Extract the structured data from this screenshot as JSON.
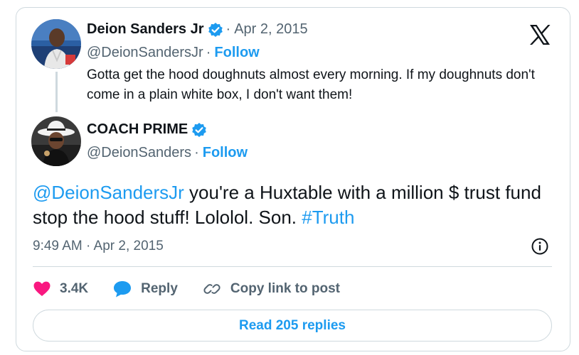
{
  "quoted_tweet": {
    "author_name": "Deion Sanders Jr",
    "handle": "@DeionSandersJr",
    "follow_label": "Follow",
    "separator": "·",
    "date": "Apr 2, 2015",
    "text": "Gotta get the hood doughnuts almost every morning. If my doughnuts don't come in a plain white box, I don't want them!"
  },
  "main_tweet": {
    "author_name": "COACH PRIME",
    "handle": "@DeionSanders",
    "follow_label": "Follow",
    "separator": "·",
    "mention": "@DeionSandersJr",
    "text_body": " you're a Huxtable with a million $ trust fund stop the hood stuff! Lololol. Son. ",
    "hashtag": "#Truth",
    "timestamp": "9:49 AM · Apr 2, 2015"
  },
  "actions": {
    "likes_count": "3.4K",
    "reply_label": "Reply",
    "copy_link_label": "Copy link to post"
  },
  "read_replies_label": "Read 205 replies",
  "icons": {
    "verified": "verified-badge-icon",
    "x_logo": "x-logo-icon",
    "info": "info-icon",
    "heart": "heart-icon",
    "reply": "reply-bubble-icon",
    "link": "link-icon"
  },
  "colors": {
    "accent": "#1d9bf0",
    "like": "#f91880",
    "text_primary": "#0f1419",
    "text_secondary": "#536471",
    "border": "#cfd9de"
  }
}
